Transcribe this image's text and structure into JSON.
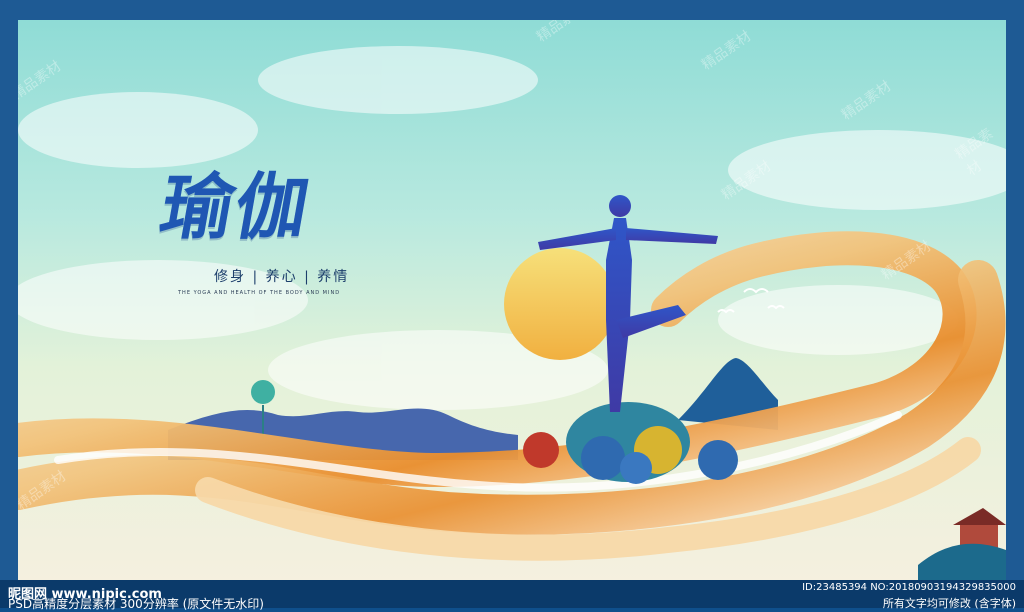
{
  "title": "瑜伽",
  "subtitle": "修身 | 养心 | 养情",
  "tiny_text": "THE YOGA AND HEALTH OF THE BODY AND MIND",
  "watermarks": [
    "精品素材",
    "精品素材",
    "精品素材",
    "精品素材",
    "精品素材",
    "精品素材",
    "精品素材",
    "精品素材"
  ],
  "footer": {
    "logo": "昵图网 www.nipic.com",
    "psd_info": "PSD高精度分层素材 300分辨率 (原文件无水印)",
    "id_line": "ID:23485394 NO:20180903194329835000",
    "note": "所有文字均可修改 (含字体)"
  },
  "colors": {
    "border": "#1e5a94",
    "title": "#1f57b3",
    "sun": "#f4cf63",
    "ribbon": "#f3b35a"
  }
}
